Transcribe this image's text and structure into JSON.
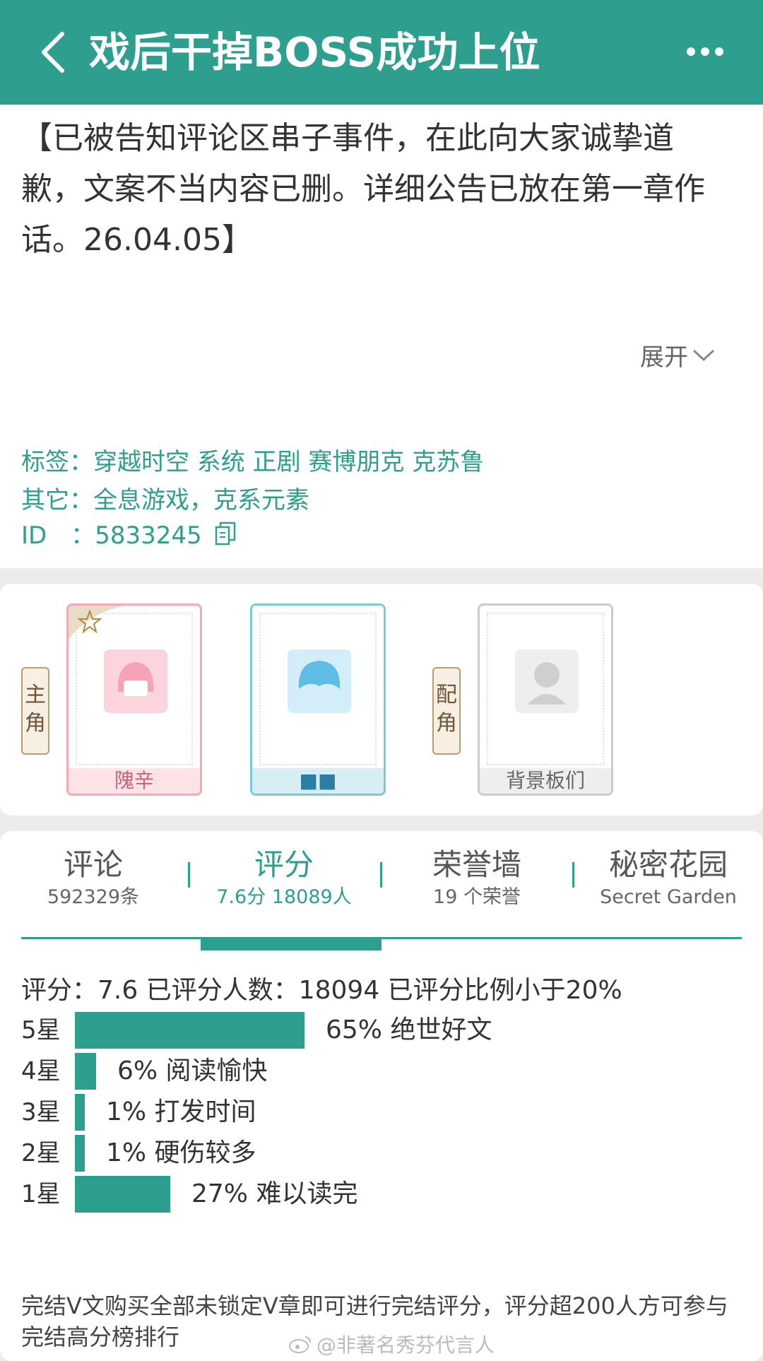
{
  "header": {
    "title": "戏后干掉BOSS成功上位",
    "back_icon": "chevron-left-icon",
    "more_icon": "more-horizontal-icon",
    "bg_color": "#2e9f8e"
  },
  "summary": {
    "announcement": "【已被告知评论区串子事件，在此向大家诚挚道歉，文案不当内容已删。详细公告已放在第一章作话。26.04.05】",
    "expand_label": "展开",
    "tags_label": "标签：",
    "tags": "穿越时空 系统 正剧 赛博朋克 克苏鲁",
    "other_label": "其它：",
    "other": "全息游戏，克系元素",
    "id_label": "ID　：",
    "id": "5833245"
  },
  "characters": {
    "main_tag": "主角",
    "support_tag": "配角",
    "cards": [
      {
        "name": "隗辛",
        "starred": true,
        "border": "#f2a9b8",
        "name_bg": "#fde2e6",
        "name_color": "#c9637a"
      },
      {
        "name": "■■",
        "starred": false,
        "border": "#7ec8d8",
        "name_bg": "#d6eef4",
        "name_color": "#2a7fa3"
      },
      {
        "name": "背景板们",
        "starred": false,
        "border": "#cccccc",
        "name_bg": "#eeeeee",
        "name_color": "#666666"
      }
    ]
  },
  "tabs": [
    {
      "label": "评论",
      "sub": "592329条",
      "active": false
    },
    {
      "label": "评分",
      "sub": "7.6分 18089人",
      "active": true
    },
    {
      "label": "荣誉墙",
      "sub": "19 个荣誉",
      "active": false
    },
    {
      "label": "秘密花园",
      "sub": "Secret Garden",
      "active": false
    }
  ],
  "rating": {
    "summary": "评分：7.6 已评分人数：18094 已评分比例小于20%",
    "rows": [
      {
        "star": "5星",
        "pct": 65,
        "text": "65%  绝世好文"
      },
      {
        "star": "4星",
        "pct": 6,
        "text": "6%  阅读愉快"
      },
      {
        "star": "3星",
        "pct": 1,
        "text": "1%  打发时间"
      },
      {
        "star": "2星",
        "pct": 1,
        "text": "1%  硬伤较多"
      },
      {
        "star": "1星",
        "pct": 27,
        "text": "27%  难以读完"
      }
    ],
    "footnote": "完结V文购买全部未锁定V章即可进行完结评分，评分超200人方可参与完结高分榜排行",
    "bar_color": "#2e9f8e"
  },
  "watermark": "@非著名秀芬代言人"
}
